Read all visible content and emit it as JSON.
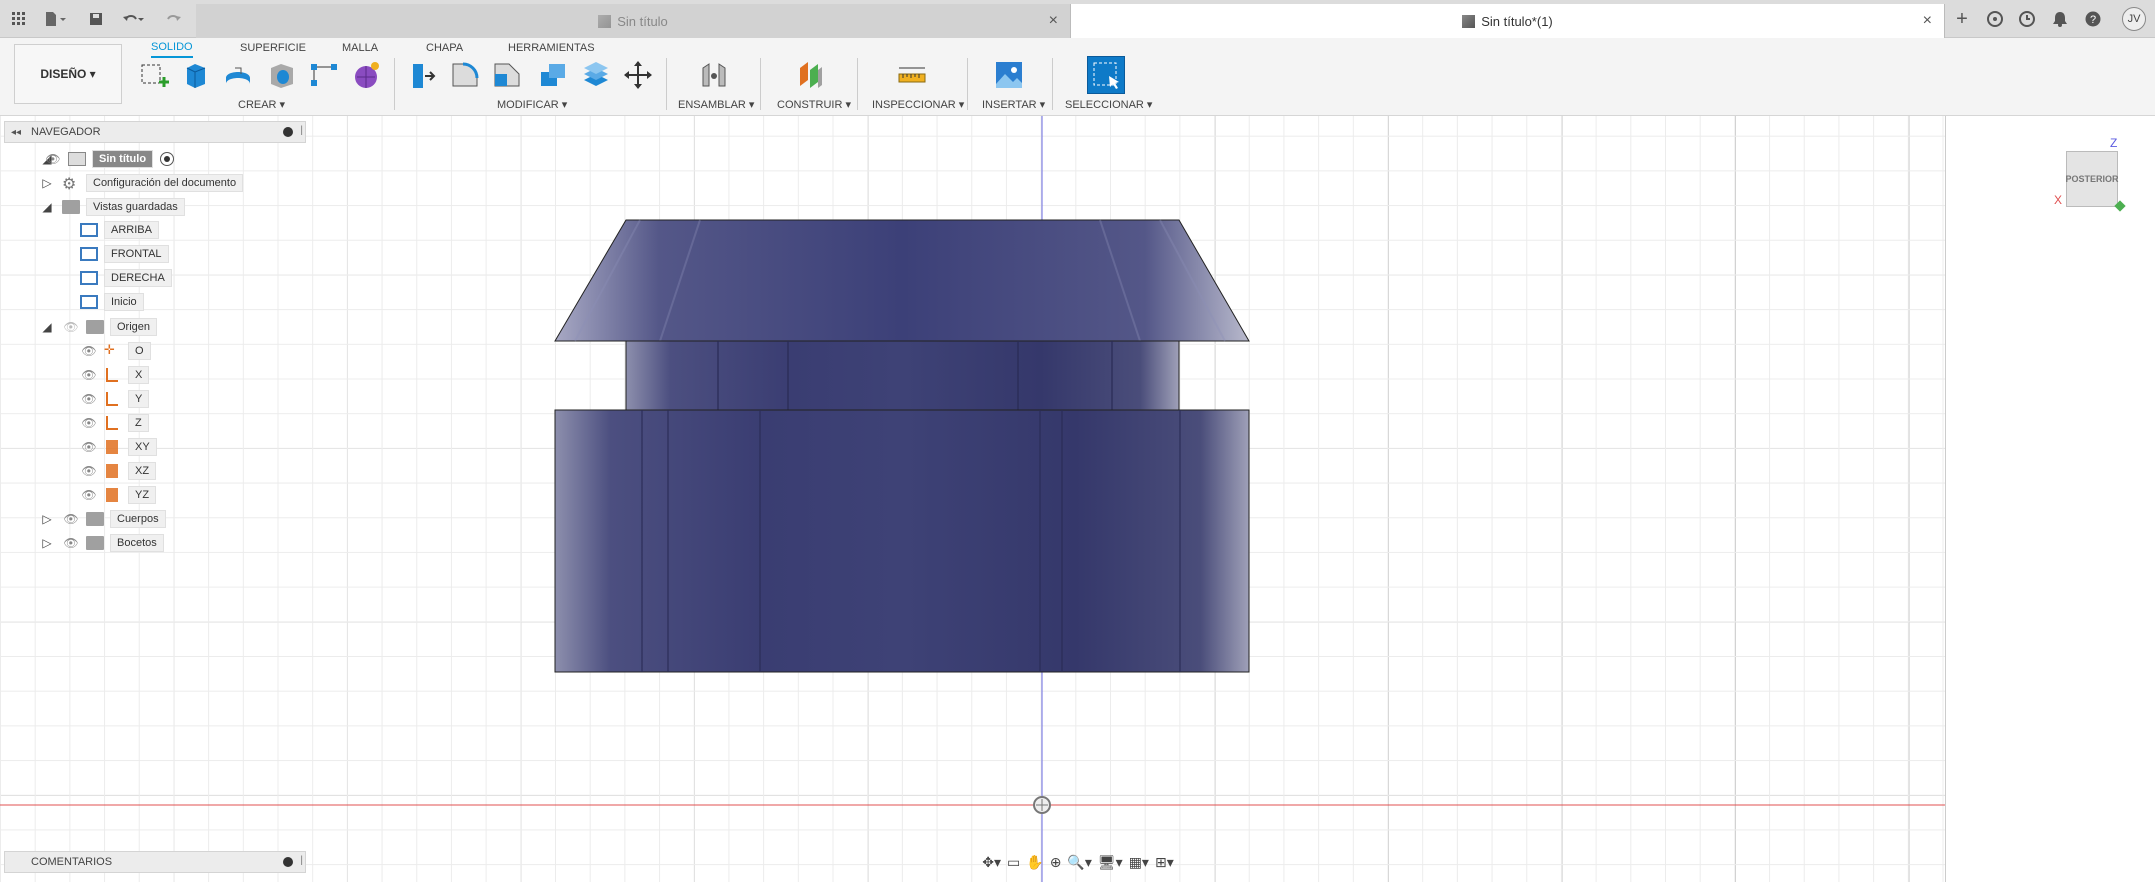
{
  "tabs": {
    "inactive": "Sin título",
    "active": "Sin título*(1)"
  },
  "user_initials": "JV",
  "workspace": "DISEÑO ▾",
  "toolbar_tabs": [
    "SOLIDO",
    "SUPERFICIE",
    "MALLA",
    "CHAPA",
    "HERRAMIENTAS"
  ],
  "groups": {
    "crear": "CREAR ▾",
    "modificar": "MODIFICAR ▾",
    "ensamblar": "ENSAMBLAR ▾",
    "construir": "CONSTRUIR ▾",
    "inspeccionar": "INSPECCIONAR ▾",
    "insertar": "INSERTAR ▾",
    "seleccionar": "SELECCIONAR ▾"
  },
  "navigator": {
    "title": "NAVEGADOR",
    "root": "Sin título",
    "config": "Configuración del documento",
    "saved_views": "Vistas guardadas",
    "views": [
      "ARRIBA",
      "FRONTAL",
      "DERECHA",
      "Inicio"
    ],
    "origin": "Origen",
    "origin_items": [
      "O",
      "X",
      "Y",
      "Z",
      "XY",
      "XZ",
      "YZ"
    ],
    "bodies": "Cuerpos",
    "sketches": "Bocetos"
  },
  "comments": "COMENTARIOS",
  "viewcube": {
    "face": "POSTERIOR",
    "axis_z": "Z",
    "axis_x": "X"
  },
  "colors": {
    "accent": "#0696d7",
    "body": "#3c3f6e",
    "origin": "#e07020"
  }
}
